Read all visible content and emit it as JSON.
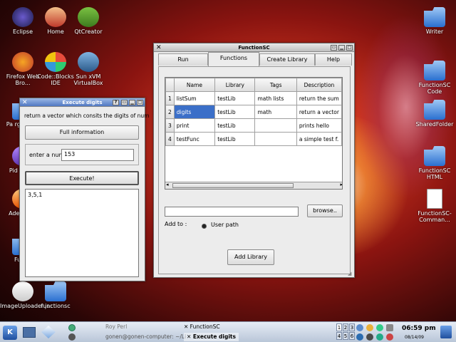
{
  "desktop": {
    "icons_left": [
      {
        "label": "Eclipse",
        "name": "eclipse-icon"
      },
      {
        "label": "Home",
        "name": "home-icon"
      },
      {
        "label": "QtCreator",
        "name": "qtcreator-icon"
      },
      {
        "label": "Firefox Web Bro...",
        "name": "firefox-icon"
      },
      {
        "label": "Code::Blocks IDE",
        "name": "codeblocks-icon"
      },
      {
        "label": "Sun xVM VirtualBox",
        "name": "virtualbox-icon"
      },
      {
        "label": "Pa rgachi di",
        "name": "folder-icon"
      },
      {
        "label": "Pid Intern",
        "name": "pidgin-icon"
      },
      {
        "label": "Ade Manu",
        "name": "application-icon"
      },
      {
        "label": "Functi",
        "name": "folder-icon"
      },
      {
        "label": "ImageUploader.jar",
        "name": "jar-icon"
      },
      {
        "label": "functionsc",
        "name": "folder-icon"
      }
    ],
    "icons_right": [
      {
        "label": "Writer",
        "name": "folder-icon"
      },
      {
        "label": "FunctionSC Code",
        "name": "folder-icon"
      },
      {
        "label": "SharedFolder",
        "name": "folder-icon"
      },
      {
        "label": "FunctionSC HTML",
        "name": "folder-icon"
      },
      {
        "label": "FunctionSC-Comman...",
        "name": "text-file-icon"
      }
    ]
  },
  "functionsc": {
    "title": "FunctionSC",
    "tabs": [
      "Run",
      "Functions",
      "Create Library",
      "Help"
    ],
    "selected_tab": 1,
    "columns": [
      "Name",
      "Library",
      "Tags",
      "Description"
    ],
    "rows": [
      [
        "1",
        "listSum",
        "testLib",
        "math lists",
        "return the sum"
      ],
      [
        "2",
        "digits",
        "testLib",
        "math",
        "return a vector"
      ],
      [
        "3",
        "print",
        "testLib",
        "",
        "prints hello"
      ],
      [
        "4",
        "testFunc",
        "testLib",
        "",
        "a simple test f."
      ]
    ],
    "selected_row": 1,
    "path_value": "",
    "browse_label": "browse..",
    "add_to_label": "Add to :",
    "user_path_label": "User path",
    "add_library_label": "Add Library"
  },
  "execute": {
    "title": "Execute digits",
    "description": "return a vector which consits the digits of num",
    "full_info_label": "Full information",
    "input_label": "enter a num",
    "input_value": "153",
    "execute_label": "Execute!",
    "output": "3,5,1"
  },
  "taskbar": {
    "tasks": [
      "Roy Perl",
      "gonen@gonen-computer: ~/Li",
      "FunctionSC",
      "Execute digits"
    ],
    "desktops": [
      "1",
      "2",
      "3",
      "4",
      "5",
      "6"
    ],
    "time": "06:59 pm",
    "date": "08/14/09"
  }
}
